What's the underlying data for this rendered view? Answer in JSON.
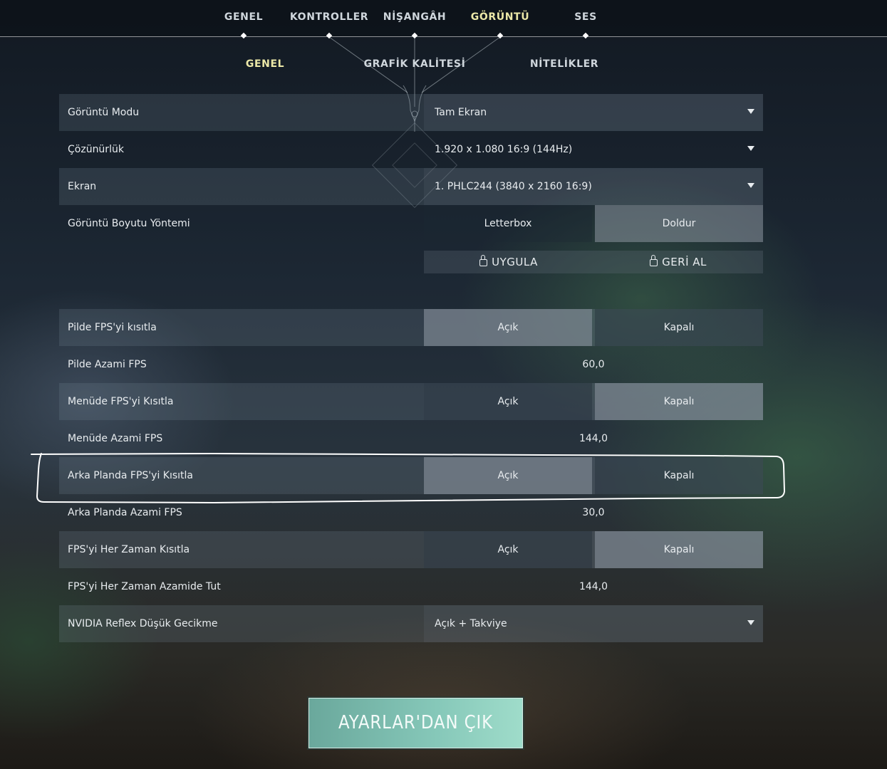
{
  "top_tabs": [
    {
      "label": "GENEL"
    },
    {
      "label": "KONTROLLER"
    },
    {
      "label": "NİŞANGÂH"
    },
    {
      "label": "GÖRÜNTÜ",
      "active": true
    },
    {
      "label": "SES"
    }
  ],
  "sub_tabs": [
    {
      "label": "GENEL",
      "active": true
    },
    {
      "label": "GRAFİK KALİTESİ"
    },
    {
      "label": "NİTELİKLER"
    }
  ],
  "display": {
    "mode": {
      "label": "Görüntü Modu",
      "value": "Tam Ekran"
    },
    "resolution": {
      "label": "Çözünürlük",
      "value": "1.920 x 1.080 16:9 (144Hz)"
    },
    "monitor": {
      "label": "Ekran",
      "value": "1. PHLC244 (3840 x  2160 16:9)"
    },
    "aspect": {
      "label": "Görüntü Boyutu Yöntemi",
      "options": [
        "Letterbox",
        "Doldur"
      ],
      "selected": "Doldur"
    }
  },
  "actions": {
    "apply": "UYGULA",
    "revert": "GERİ AL"
  },
  "fps": {
    "limit_battery": {
      "label": "Pilde FPS'yi kısıtla",
      "on": "Açık",
      "off": "Kapalı",
      "selected": "Açık"
    },
    "max_battery": {
      "label": "Pilde Azami FPS",
      "value": "60,0"
    },
    "limit_menu": {
      "label": "Menüde FPS'yi Kısıtla",
      "on": "Açık",
      "off": "Kapalı",
      "selected": "Kapalı"
    },
    "max_menu": {
      "label": "Menüde Azami FPS",
      "value": "144,0"
    },
    "limit_background": {
      "label": "Arka Planda FPS'yi Kısıtla",
      "on": "Açık",
      "off": "Kapalı",
      "selected": "Açık"
    },
    "max_background": {
      "label": "Arka Planda Azami FPS",
      "value": "30,0"
    },
    "limit_always": {
      "label": "FPS'yi Her Zaman Kısıtla",
      "on": "Açık",
      "off": "Kapalı",
      "selected": "Kapalı"
    },
    "max_always": {
      "label": "FPS'yi Her Zaman Azamide Tut",
      "value": "144,0"
    },
    "reflex": {
      "label": "NVIDIA Reflex Düşük Gecikme",
      "value": "Açık + Takviye"
    }
  },
  "exit_button": "AYARLAR'DAN ÇIK",
  "colors": {
    "active_tab": "#ece8a8",
    "exit_button": "#86c8b9",
    "annotation": "#ffffff"
  }
}
